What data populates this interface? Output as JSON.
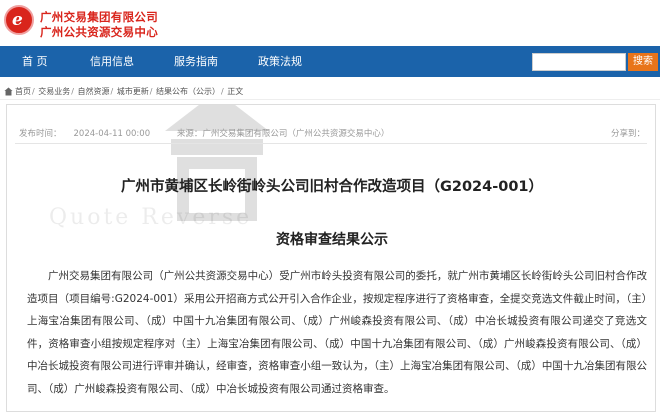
{
  "header": {
    "logo_letter": "e",
    "org_line1": "广州交易集团有限公司",
    "org_line2": "广州公共资源交易中心"
  },
  "nav": {
    "items": [
      {
        "label": "首 页"
      },
      {
        "label": "信用信息"
      },
      {
        "label": "服务指南"
      },
      {
        "label": "政策法规"
      }
    ]
  },
  "search": {
    "placeholder": "",
    "button_label": "搜索"
  },
  "breadcrumb": {
    "items": [
      "首页",
      "交易业务",
      "自然资源",
      "城市更新",
      "结果公布（公示）",
      "正文"
    ],
    "separator": "/"
  },
  "article": {
    "date": "2024-04-11 00:00",
    "date_label": "发布时间：",
    "source": "来源：广州交易集团有限公司（广州公共资源交易中心）",
    "share": "分享到：",
    "title": "广州市黄埔区长岭街岭头公司旧村合作改造项目（G2024-001）",
    "subtitle": "资格审查结果公示",
    "watermark_text": "Quote Reverse",
    "body": "广州交易集团有限公司（广州公共资源交易中心）受广州市岭头投资有限公司的委托，就广州市黄埔区长岭街岭头公司旧村合作改造项目（项目编号:G2024-001）采用公开招商方式公开引入合作企业，按规定程序进行了资格审查，全提交竞选文件截止时间，（主）上海宝冶集团有限公司、（成）中国十九冶集团有限公司、（成）广州峻森投资有限公司、（成）中冶长城投资有限公司递交了竞选文件，资格审查小组按规定程序对（主）上海宝冶集团有限公司、（成）中国十九冶集团有限公司、（成）广州峻森投资有限公司、（成）中冶长城投资有限公司进行评审并确认，经审查，资格审查小组一致认为，（主）上海宝冶集团有限公司、（成）中国十九冶集团有限公司、（成）广州峻森投资有限公司、（成）中冶长城投资有限公司通过资格审查。"
  },
  "colors": {
    "brand_red": "#d9251c",
    "nav_blue": "#1b63aa",
    "search_orange": "#e8741a"
  }
}
